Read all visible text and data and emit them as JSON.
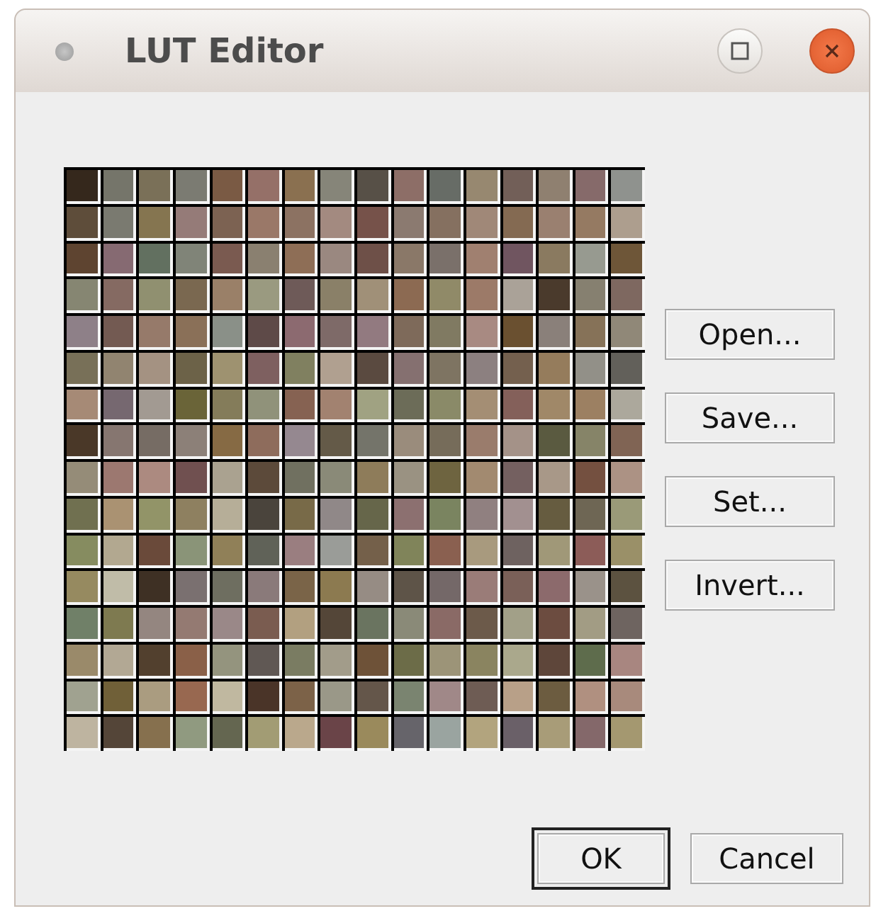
{
  "window": {
    "title": "LUT Editor"
  },
  "lut": {
    "rows": [
      [
        {
          "color": "#35281c"
        },
        {
          "color": "#75756a"
        },
        {
          "color": "#7a7058"
        },
        {
          "color": "#7b7b72"
        },
        {
          "color": "#7a5a44"
        },
        {
          "color": "#957068"
        },
        {
          "color": "#8a7050"
        },
        {
          "color": "#868579"
        },
        {
          "color": "#575047"
        },
        {
          "color": "#8d6e67"
        },
        {
          "color": "#676c66"
        },
        {
          "color": "#978870"
        },
        {
          "color": "#725f58"
        },
        {
          "color": "#8f8070"
        },
        {
          "color": "#866a6a"
        },
        {
          "color": "#8f928e"
        }
      ],
      [
        {
          "color": "#5e4d3a"
        },
        {
          "color": "#7a7a70"
        },
        {
          "color": "#857550"
        },
        {
          "color": "#957b78"
        },
        {
          "color": "#7c6252"
        },
        {
          "color": "#9a7868"
        },
        {
          "color": "#8c7262"
        },
        {
          "color": "#a38a80"
        },
        {
          "color": "#76524a"
        },
        {
          "color": "#8b7a70"
        },
        {
          "color": "#857060"
        },
        {
          "color": "#a08878"
        },
        {
          "color": "#846a52"
        },
        {
          "color": "#9a8070"
        },
        {
          "color": "#957a62"
        },
        {
          "color": "#ad9e8e"
        }
      ],
      [
        {
          "color": "#5e4430"
        },
        {
          "color": "#866a72"
        },
        {
          "color": "#627060"
        },
        {
          "color": "#808478"
        },
        {
          "color": "#7a5a50"
        },
        {
          "color": "#8a8070"
        },
        {
          "color": "#8e6e56"
        },
        {
          "color": "#9a8880"
        },
        {
          "color": "#6e5048"
        },
        {
          "color": "#8a7868"
        },
        {
          "color": "#7a706a"
        },
        {
          "color": "#a08070"
        },
        {
          "color": "#705560"
        },
        {
          "color": "#8a7a60"
        },
        {
          "color": "#979a90"
        },
        {
          "color": "#6e5638"
        }
      ],
      [
        {
          "color": "#868672"
        },
        {
          "color": "#856a62"
        },
        {
          "color": "#909070"
        },
        {
          "color": "#7a6850"
        },
        {
          "color": "#9a8068"
        },
        {
          "color": "#9a9a80"
        },
        {
          "color": "#6e5a58"
        },
        {
          "color": "#8a8068"
        },
        {
          "color": "#a09078"
        },
        {
          "color": "#8c6a52"
        },
        {
          "color": "#908a68"
        },
        {
          "color": "#9c7a68"
        },
        {
          "color": "#aaa298"
        },
        {
          "color": "#4a3a2c"
        },
        {
          "color": "#868070"
        },
        {
          "color": "#7e6860"
        }
      ],
      [
        {
          "color": "#8e8088"
        },
        {
          "color": "#735a52"
        },
        {
          "color": "#967a6a"
        },
        {
          "color": "#8a7058"
        },
        {
          "color": "#8a9088"
        },
        {
          "color": "#5e4a48"
        },
        {
          "color": "#8c6a70"
        },
        {
          "color": "#7e6a68"
        },
        {
          "color": "#927a80"
        },
        {
          "color": "#7e6a5a"
        },
        {
          "color": "#807a62"
        },
        {
          "color": "#a88a82"
        },
        {
          "color": "#6a5030"
        },
        {
          "color": "#8a807a"
        },
        {
          "color": "#867258"
        },
        {
          "color": "#908878"
        }
      ],
      [
        {
          "color": "#787058"
        },
        {
          "color": "#918470"
        },
        {
          "color": "#a49282"
        },
        {
          "color": "#6c6248"
        },
        {
          "color": "#9e9270"
        },
        {
          "color": "#7e6060"
        },
        {
          "color": "#808060"
        },
        {
          "color": "#b0a090"
        },
        {
          "color": "#5a4a40"
        },
        {
          "color": "#857070"
        },
        {
          "color": "#7e7462"
        },
        {
          "color": "#8c8080"
        },
        {
          "color": "#74604e"
        },
        {
          "color": "#957c5c"
        },
        {
          "color": "#929088"
        },
        {
          "color": "#62605a"
        }
      ],
      [
        {
          "color": "#a68a76"
        },
        {
          "color": "#766870"
        },
        {
          "color": "#a29a92"
        },
        {
          "color": "#6a6438"
        },
        {
          "color": "#847c5a"
        },
        {
          "color": "#90927a"
        },
        {
          "color": "#866252"
        },
        {
          "color": "#a28270"
        },
        {
          "color": "#a0a282"
        },
        {
          "color": "#6c6c58"
        },
        {
          "color": "#8a8a68"
        },
        {
          "color": "#a48e74"
        },
        {
          "color": "#84605a"
        },
        {
          "color": "#a08868"
        },
        {
          "color": "#9c8062"
        },
        {
          "color": "#aca89c"
        }
      ],
      [
        {
          "color": "#4a3828"
        },
        {
          "color": "#867670"
        },
        {
          "color": "#766c64"
        },
        {
          "color": "#8c8078"
        },
        {
          "color": "#866a44"
        },
        {
          "color": "#8e6c5c"
        },
        {
          "color": "#958890"
        },
        {
          "color": "#645a48"
        },
        {
          "color": "#74746a"
        },
        {
          "color": "#9a8c7c"
        },
        {
          "color": "#766c5a"
        },
        {
          "color": "#9a7c6c"
        },
        {
          "color": "#a49288"
        },
        {
          "color": "#5a5a40"
        },
        {
          "color": "#868468"
        },
        {
          "color": "#806454"
        }
      ],
      [
        {
          "color": "#958c78"
        },
        {
          "color": "#9c7870"
        },
        {
          "color": "#ac8a80"
        },
        {
          "color": "#705050"
        },
        {
          "color": "#aaa290"
        },
        {
          "color": "#5c4a3a"
        },
        {
          "color": "#707060"
        },
        {
          "color": "#8a8a78"
        },
        {
          "color": "#8e7c5a"
        },
        {
          "color": "#9a9282"
        },
        {
          "color": "#6e6440"
        },
        {
          "color": "#a28a70"
        },
        {
          "color": "#746060"
        },
        {
          "color": "#a89888"
        },
        {
          "color": "#745040"
        },
        {
          "color": "#ac9284"
        }
      ],
      [
        {
          "color": "#707050"
        },
        {
          "color": "#aa9272"
        },
        {
          "color": "#929468"
        },
        {
          "color": "#8e8060"
        },
        {
          "color": "#b6ae98"
        },
        {
          "color": "#4a443c"
        },
        {
          "color": "#786a48"
        },
        {
          "color": "#908888"
        },
        {
          "color": "#66664a"
        },
        {
          "color": "#8c7070"
        },
        {
          "color": "#7a8460"
        },
        {
          "color": "#908080"
        },
        {
          "color": "#a29090"
        },
        {
          "color": "#665c40"
        },
        {
          "color": "#6e6654"
        },
        {
          "color": "#9a9a78"
        }
      ],
      [
        {
          "color": "#868c60"
        },
        {
          "color": "#b2a890"
        },
        {
          "color": "#6a4a3a"
        },
        {
          "color": "#8a9478"
        },
        {
          "color": "#908058"
        },
        {
          "color": "#606258"
        },
        {
          "color": "#9a7e80"
        },
        {
          "color": "#9a9c98"
        },
        {
          "color": "#74604a"
        },
        {
          "color": "#80845a"
        },
        {
          "color": "#8a6050"
        },
        {
          "color": "#a89a7e"
        },
        {
          "color": "#6e6260"
        },
        {
          "color": "#a09878"
        },
        {
          "color": "#8c5c58"
        },
        {
          "color": "#9a9068"
        }
      ],
      [
        {
          "color": "#968a60"
        },
        {
          "color": "#c0bca8"
        },
        {
          "color": "#3e3024"
        },
        {
          "color": "#7a7070"
        },
        {
          "color": "#6e6e60"
        },
        {
          "color": "#8a7a7a"
        },
        {
          "color": "#7a6448"
        },
        {
          "color": "#8c7a50"
        },
        {
          "color": "#968c84"
        },
        {
          "color": "#5e5448"
        },
        {
          "color": "#746868"
        },
        {
          "color": "#9a7c78"
        },
        {
          "color": "#7a6058"
        },
        {
          "color": "#8c6a6c"
        },
        {
          "color": "#9a928a"
        },
        {
          "color": "#5c5240"
        }
      ],
      [
        {
          "color": "#708068"
        },
        {
          "color": "#7e7a50"
        },
        {
          "color": "#948680"
        },
        {
          "color": "#947a72"
        },
        {
          "color": "#9a8888"
        },
        {
          "color": "#7a5c50"
        },
        {
          "color": "#b2a080"
        },
        {
          "color": "#544638"
        },
        {
          "color": "#6a7460"
        },
        {
          "color": "#8a8a78"
        },
        {
          "color": "#8a6a66"
        },
        {
          "color": "#6c5a4a"
        },
        {
          "color": "#a2a088"
        },
        {
          "color": "#6c4c40"
        },
        {
          "color": "#a29c84"
        },
        {
          "color": "#6e6460"
        }
      ],
      [
        {
          "color": "#9a8a6a"
        },
        {
          "color": "#b2a894"
        },
        {
          "color": "#52402e"
        },
        {
          "color": "#8a6048"
        },
        {
          "color": "#94947e"
        },
        {
          "color": "#605854"
        },
        {
          "color": "#7a7c62"
        },
        {
          "color": "#a29c8a"
        },
        {
          "color": "#6e5238"
        },
        {
          "color": "#6c6c48"
        },
        {
          "color": "#9c9478"
        },
        {
          "color": "#8a8460"
        },
        {
          "color": "#aaa88c"
        },
        {
          "color": "#5e463a"
        },
        {
          "color": "#5e6c4c"
        },
        {
          "color": "#a88680"
        }
      ],
      [
        {
          "color": "#a0a290"
        },
        {
          "color": "#706038"
        },
        {
          "color": "#aa9c80"
        },
        {
          "color": "#986850"
        },
        {
          "color": "#c0b8a0"
        },
        {
          "color": "#4a3428"
        },
        {
          "color": "#7c6248"
        },
        {
          "color": "#9a9888"
        },
        {
          "color": "#64564a"
        },
        {
          "color": "#7a8470"
        },
        {
          "color": "#a08888"
        },
        {
          "color": "#6e5c54"
        },
        {
          "color": "#b8a088"
        },
        {
          "color": "#6c5c40"
        },
        {
          "color": "#b09080"
        },
        {
          "color": "#a88a7c"
        }
      ],
      [
        {
          "color": "#beb4a0"
        },
        {
          "color": "#544538"
        },
        {
          "color": "#86704e"
        },
        {
          "color": "#909a80"
        },
        {
          "color": "#646650"
        },
        {
          "color": "#a29c74"
        },
        {
          "color": "#baa88c"
        },
        {
          "color": "#6a4448"
        },
        {
          "color": "#9a8a5c"
        },
        {
          "color": "#66646a"
        },
        {
          "color": "#9aa4a0"
        },
        {
          "color": "#b2a47e"
        },
        {
          "color": "#6a6068"
        },
        {
          "color": "#a89c78"
        },
        {
          "color": "#84686a"
        },
        {
          "color": "#a49870"
        }
      ]
    ]
  },
  "side_buttons": [
    {
      "label": "Open..."
    },
    {
      "label": "Save..."
    },
    {
      "label": "Set..."
    },
    {
      "label": "Invert..."
    }
  ],
  "bottom_buttons": [
    {
      "label": "OK",
      "default": true
    },
    {
      "label": "Cancel",
      "default": false
    }
  ]
}
